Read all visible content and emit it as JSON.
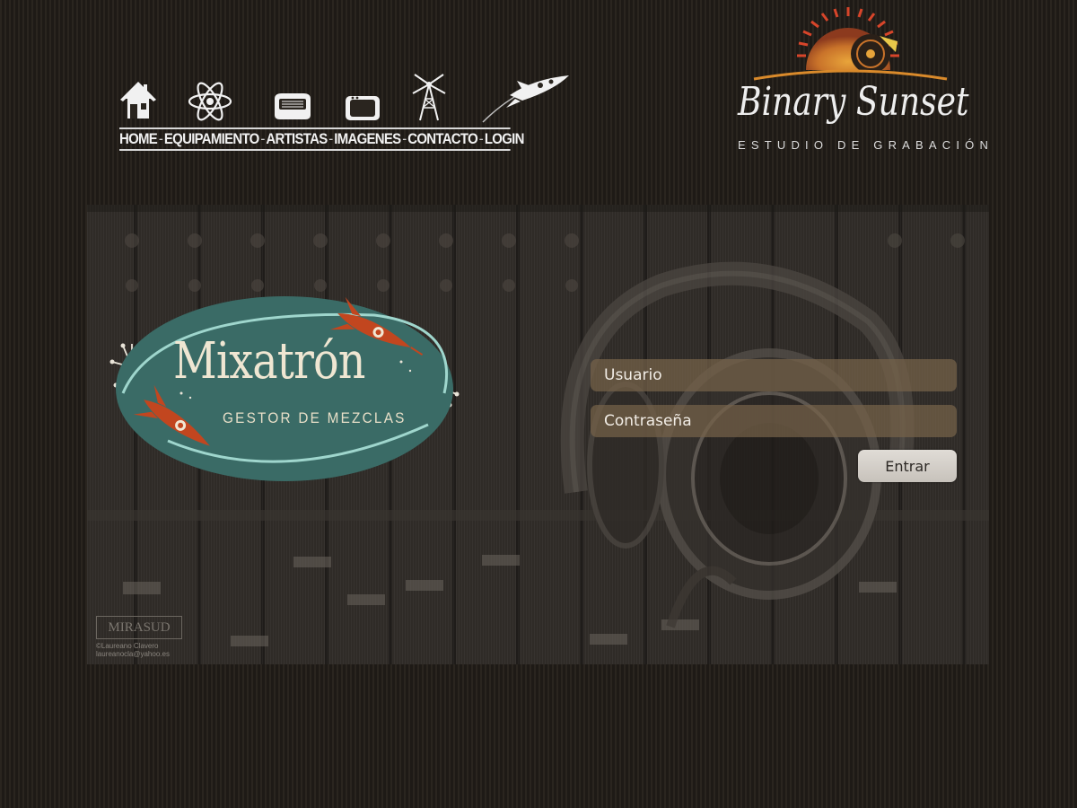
{
  "nav": {
    "items": [
      {
        "label": "HOME",
        "icon": "house-icon"
      },
      {
        "label": "EQUIPAMIENTO",
        "icon": "atom-icon"
      },
      {
        "label": "ARTISTAS",
        "icon": "radio-icon"
      },
      {
        "label": "IMAGENES",
        "icon": "tv-icon"
      },
      {
        "label": "CONTACTO",
        "icon": "antenna-tower-icon"
      },
      {
        "label": "LOGIN",
        "icon": "rocket-icon"
      }
    ],
    "separator": "-"
  },
  "brand": {
    "name": "Binary Sunset",
    "subtitle": "ESTUDIO DE GRABACIÓN",
    "logo_icon": "sunset-vinyl-icon",
    "accent_color": "#d98a2b"
  },
  "app_logo": {
    "title": "Mixatrón",
    "subtitle": "GESTOR DE MEZCLAS",
    "oval_color": "#3a6b66",
    "rocket_color": "#c2461f"
  },
  "hero": {
    "background": "mixing-console-with-headphones",
    "credit_logo": "MIRASUD",
    "credit_lines": [
      "©Laureano Clavero",
      "laureanocla@yahoo.es"
    ]
  },
  "login": {
    "username_placeholder": "Usuario",
    "password_placeholder": "Contraseña",
    "submit_label": "Entrar"
  }
}
